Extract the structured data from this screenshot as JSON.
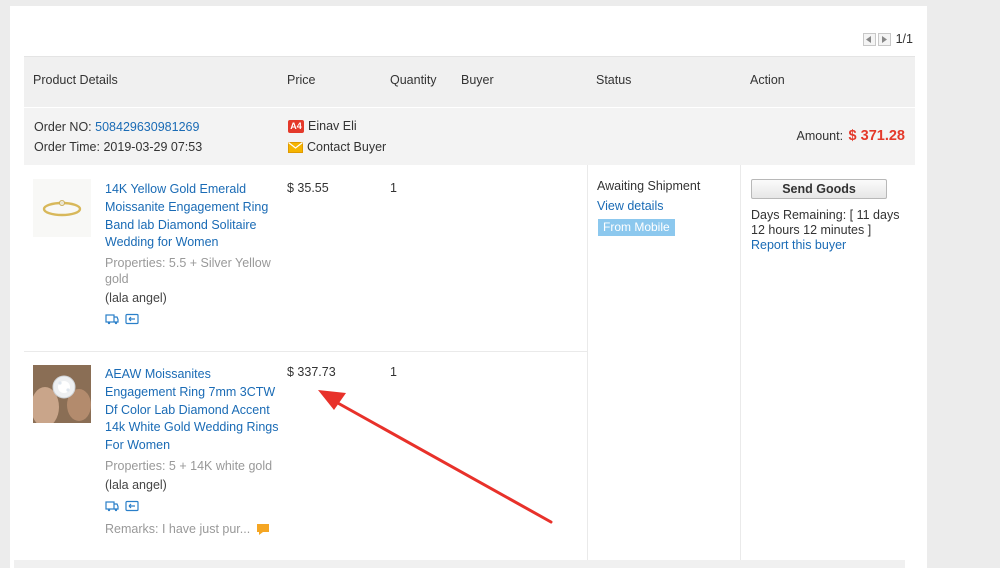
{
  "pager": {
    "text": "1/1"
  },
  "columns": {
    "product_details": "Product Details",
    "price": "Price",
    "quantity": "Quantity",
    "buyer": "Buyer",
    "status": "Status",
    "action": "Action"
  },
  "order": {
    "no_label": "Order NO:",
    "no_value": "508429630981269",
    "time_label": "Order Time:",
    "time_value": "2019-03-29 07:53",
    "buyer_badge": "A4",
    "buyer_name": "Einav Eli",
    "contact_buyer": "Contact Buyer",
    "amount_label": "Amount:",
    "amount_value": "$ 371.28"
  },
  "items": [
    {
      "name": "14K Yellow Gold Emerald Moissanite Engagement Ring Band lab Diamond Solitaire Wedding for Women",
      "properties": "Properties: 5.5 + Silver Yellow gold",
      "store": "(lala angel)",
      "price": "$ 35.55",
      "quantity": "1"
    },
    {
      "name": "AEAW Moissanites Engagement Ring 7mm 3CTW Df Color Lab Diamond Accent 14k White Gold Wedding Rings For Women",
      "properties": "Properties: 5 + 14K white gold",
      "store": "(lala angel)",
      "price": "$ 337.73",
      "quantity": "1",
      "remarks": "Remarks: I have just pur..."
    }
  ],
  "status": {
    "text": "Awaiting Shipment",
    "view_details": "View details",
    "from_mobile": "From Mobile"
  },
  "action": {
    "send_goods": "Send Goods",
    "days_remaining": "Days Remaining: [ 11 days 12 hours 12 minutes ]",
    "report_buyer": "Report this buyer"
  },
  "colors": {
    "link": "#1a6bb5",
    "amount": "#e4392a",
    "annotation_arrow": "#e8312a",
    "from_mobile_bg": "#8cc8ee"
  }
}
